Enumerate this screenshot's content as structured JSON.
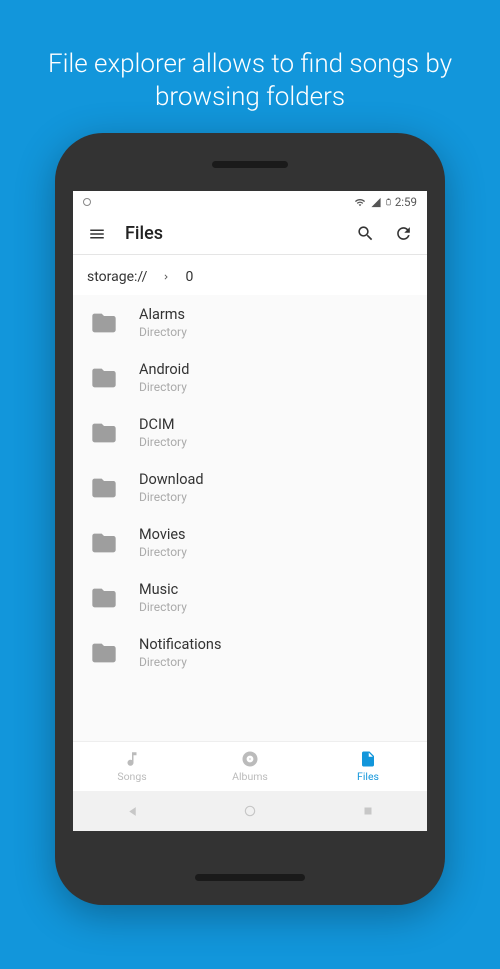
{
  "promo": "File explorer allows to find songs by browsing folders",
  "status": {
    "time": "2:59"
  },
  "appbar": {
    "title": "Files"
  },
  "breadcrumb": {
    "root": "storage://",
    "current": "0"
  },
  "files": [
    {
      "name": "Alarms",
      "type": "Directory"
    },
    {
      "name": "Android",
      "type": "Directory"
    },
    {
      "name": "DCIM",
      "type": "Directory"
    },
    {
      "name": "Download",
      "type": "Directory"
    },
    {
      "name": "Movies",
      "type": "Directory"
    },
    {
      "name": "Music",
      "type": "Directory"
    },
    {
      "name": "Notifications",
      "type": "Directory"
    }
  ],
  "tabs": [
    {
      "label": "Songs"
    },
    {
      "label": "Albums"
    },
    {
      "label": "Files"
    }
  ]
}
